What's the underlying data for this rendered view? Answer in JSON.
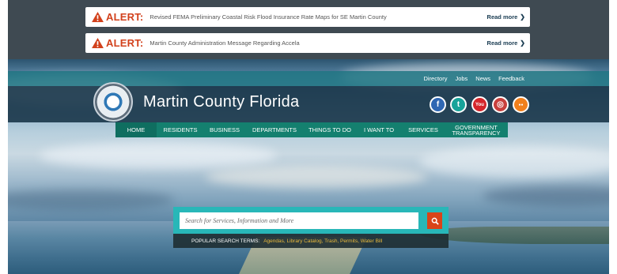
{
  "alerts": [
    {
      "label": "ALERT:",
      "text": "Revised FEMA Preliminary Coastal Risk Flood Insurance Rate Maps for SE Martin County",
      "link": "Read more"
    },
    {
      "label": "ALERT:",
      "text": "Martin County Administration Message Regarding Accela",
      "link": "Read more"
    }
  ],
  "utility_nav": [
    "Directory",
    "Jobs",
    "News",
    "Feedback"
  ],
  "site_title": "Martin County Florida",
  "social": {
    "facebook": "f",
    "twitter": "t",
    "youtube": "You",
    "instagram": "◎",
    "flickr": "●●"
  },
  "main_nav": [
    "HOME",
    "RESIDENTS",
    "BUSINESS",
    "DEPARTMENTS",
    "THINGS TO DO",
    "I WANT TO",
    "SERVICES",
    "GOVERNMENT TRANSPARENCY"
  ],
  "search": {
    "placeholder": "Search for Services, Information and More",
    "popular_label": "POPULAR SEARCH TERMS:",
    "popular_terms": "Agendas, Library Catalog, Trash, Permits, Water Bill"
  },
  "colors": {
    "alert_red": "#d2411c",
    "nav_teal": "#14806f",
    "search_teal": "#28b7b8",
    "search_button": "#d94418"
  }
}
